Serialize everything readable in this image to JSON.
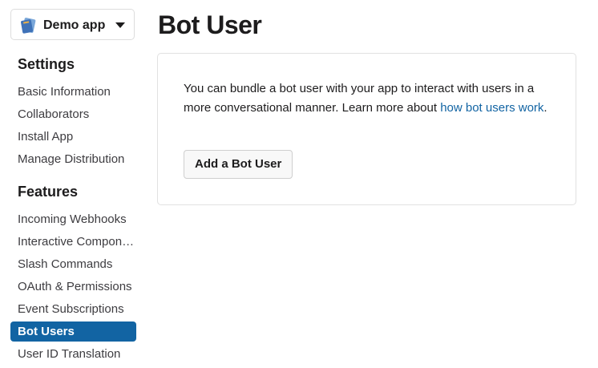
{
  "app_switcher": {
    "app_name": "Demo app",
    "icon": "app-book-icon",
    "caret": "caret-down-icon"
  },
  "sidebar": {
    "settings_heading": "Settings",
    "settings_items": [
      {
        "label": "Basic Information"
      },
      {
        "label": "Collaborators"
      },
      {
        "label": "Install App"
      },
      {
        "label": "Manage Distribution"
      }
    ],
    "features_heading": "Features",
    "features_items": [
      {
        "label": "Incoming Webhooks"
      },
      {
        "label": "Interactive Components"
      },
      {
        "label": "Slash Commands"
      },
      {
        "label": "OAuth & Permissions"
      },
      {
        "label": "Event Subscriptions"
      },
      {
        "label": "Bot Users",
        "active": true
      },
      {
        "label": "User ID Translation"
      }
    ]
  },
  "main": {
    "title": "Bot User",
    "card": {
      "text_before_link": "You can bundle a bot user with your app to interact with users in a more conversational manner. Learn more about ",
      "link_text": "how bot users work",
      "text_after_link": ".",
      "button_label": "Add a Bot User"
    }
  },
  "colors": {
    "accent": "#1264a3",
    "text": "#1d1c1d",
    "nav_text": "#3d3c40",
    "border": "#e1e1e1"
  }
}
